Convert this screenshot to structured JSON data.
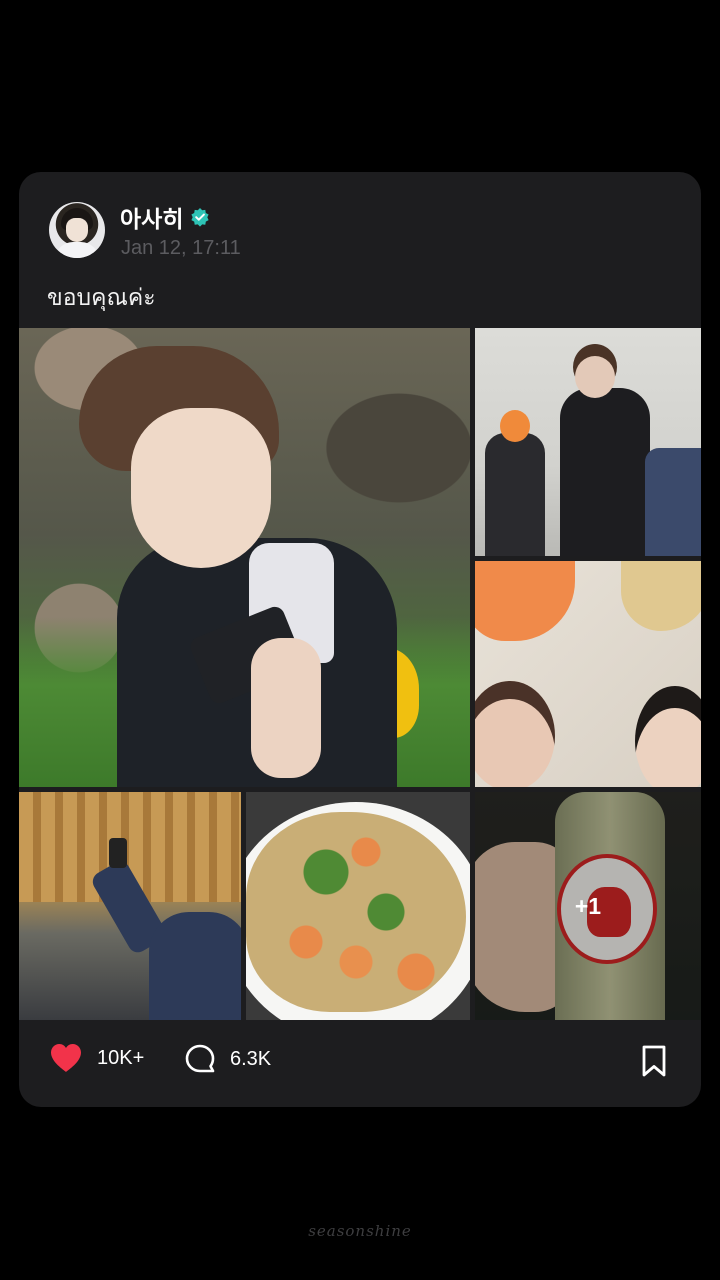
{
  "post": {
    "username": "아사히",
    "verified": true,
    "timestamp": "Jan 12, 17:11",
    "caption": "ขอบคุณค่ะ",
    "photos": [
      {
        "name": "selfie-with-phone"
      },
      {
        "name": "mirror-group-photo"
      },
      {
        "name": "group-selfie"
      },
      {
        "name": "restaurant-photo"
      },
      {
        "name": "shrimp-fried-rice"
      },
      {
        "name": "soda-bottle",
        "more_count": "+1"
      }
    ],
    "likes": "10K+",
    "comments": "6.3K"
  },
  "watermark": "seasonshine",
  "colors": {
    "background": "#000000",
    "card": "#1d1d1f",
    "verified_badge": "#2ec4b6",
    "like_heart": "#f2334a",
    "timestamp": "#5c5c60"
  },
  "icons": {
    "verified": "verified-badge-icon",
    "like": "heart-icon",
    "comment": "comment-bubble-icon",
    "save": "bookmark-icon"
  }
}
